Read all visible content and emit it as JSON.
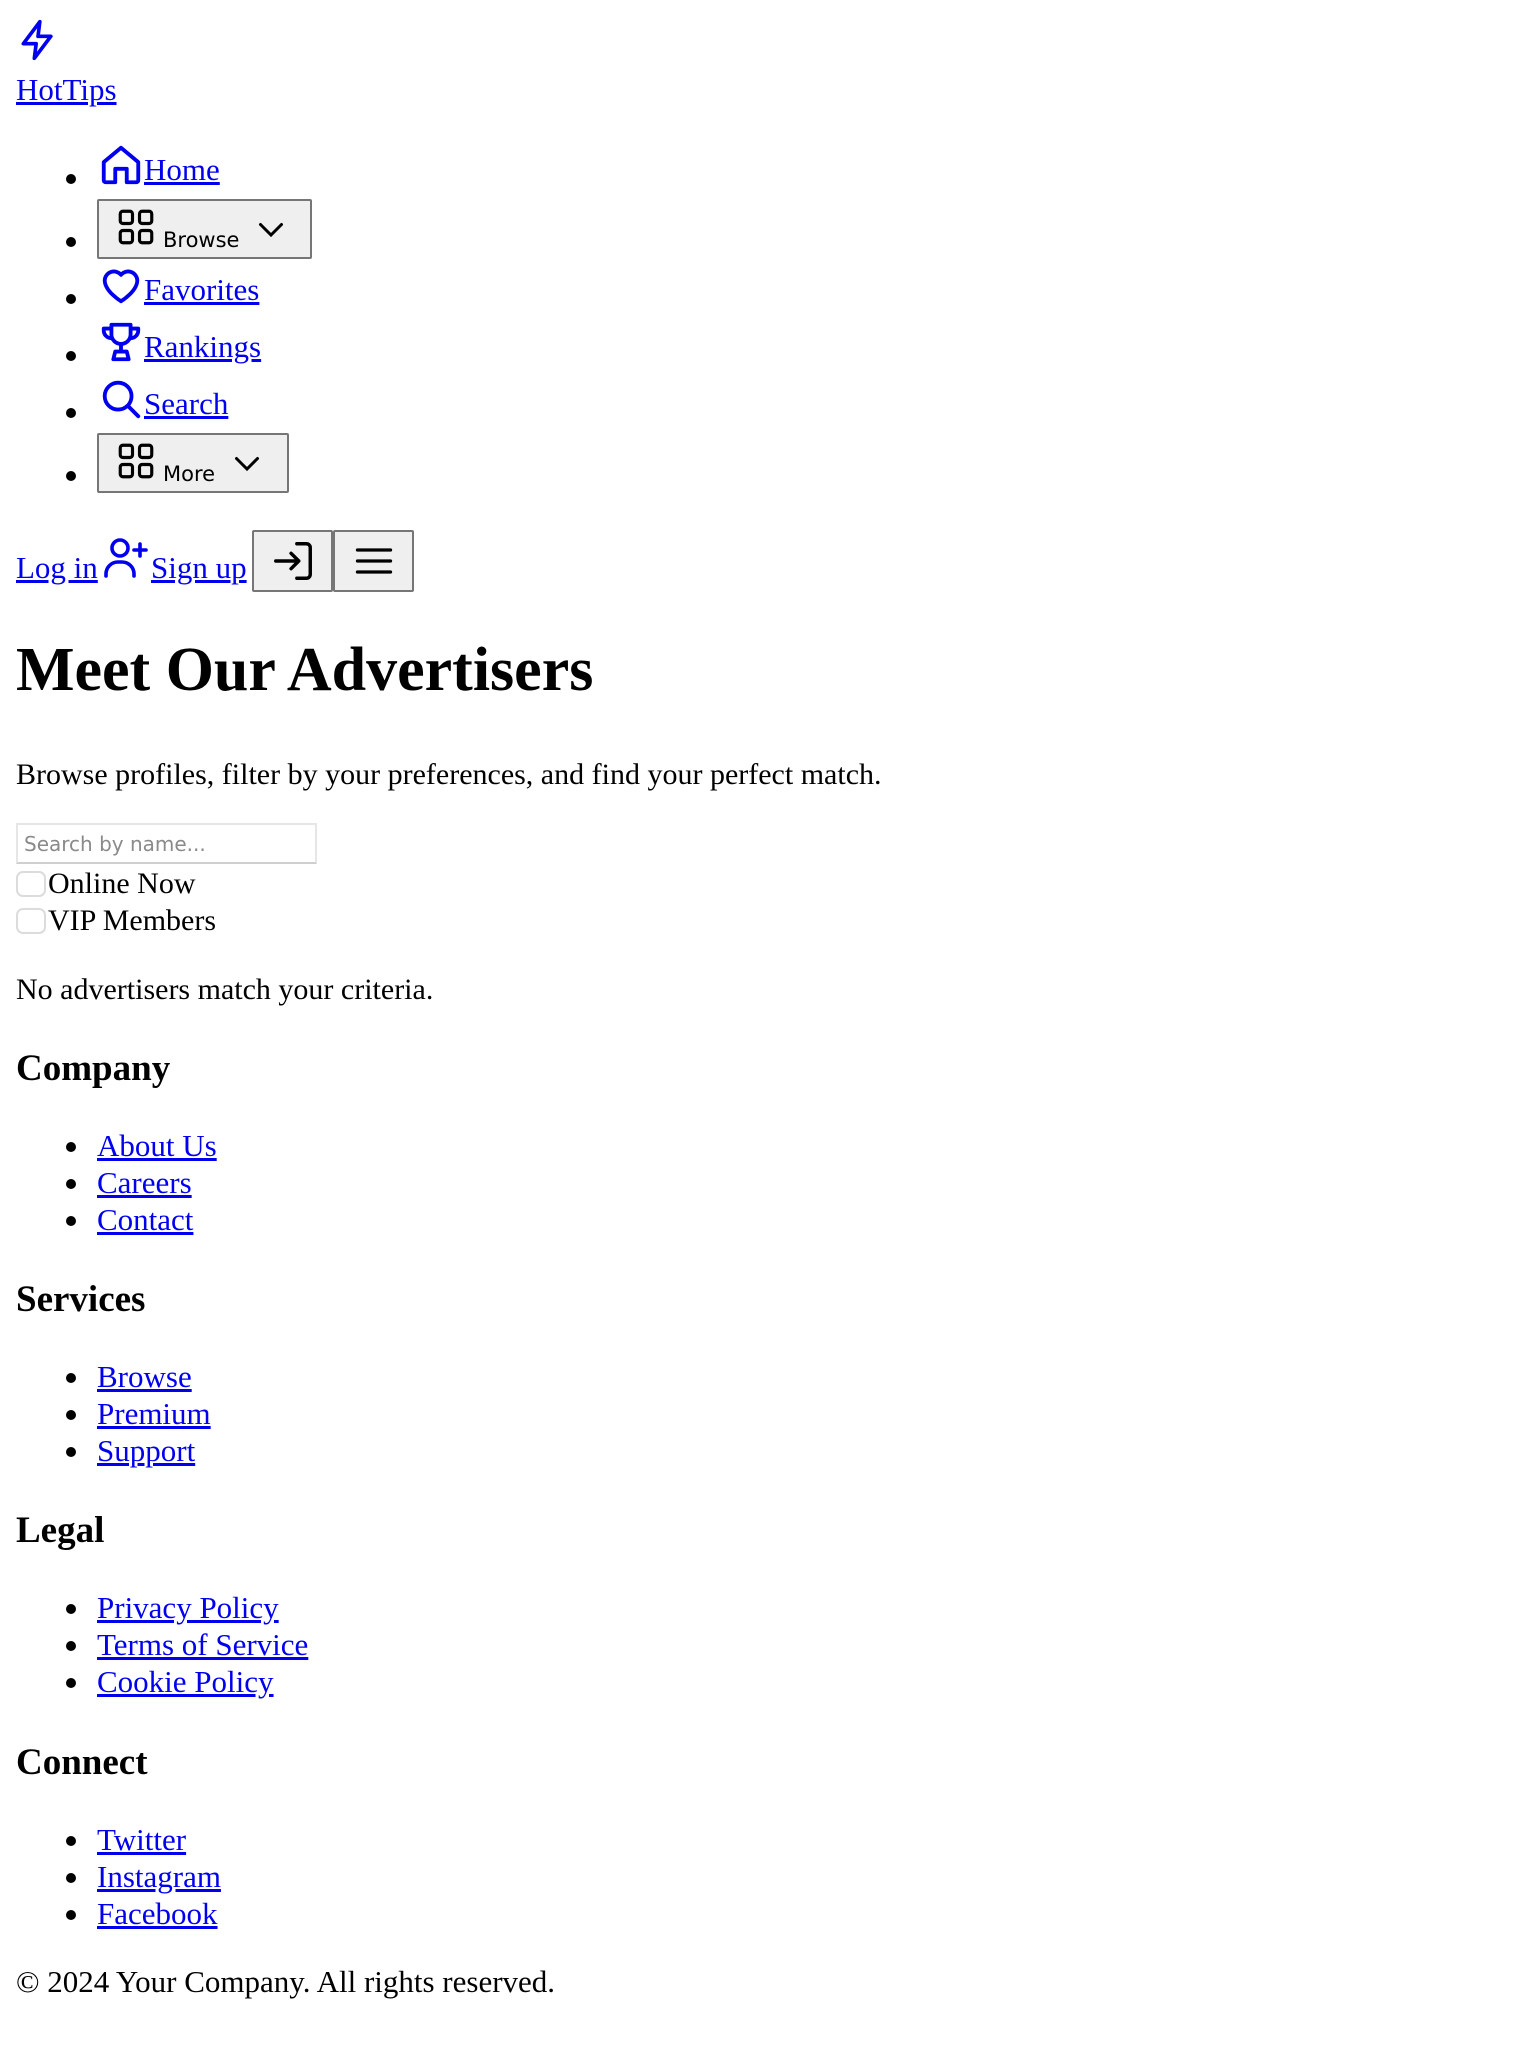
{
  "brand": {
    "name": "HotTips",
    "icon": "lightning-icon"
  },
  "nav": {
    "items": [
      {
        "label": "Home",
        "icon": "home-icon",
        "type": "link"
      },
      {
        "label": "Browse",
        "icon": "grid-icon",
        "type": "dropdown"
      },
      {
        "label": "Favorites",
        "icon": "heart-icon",
        "type": "link"
      },
      {
        "label": "Rankings",
        "icon": "trophy-icon",
        "type": "link"
      },
      {
        "label": "Search",
        "icon": "search-icon",
        "type": "link"
      },
      {
        "label": "More",
        "icon": "grid-icon",
        "type": "dropdown"
      }
    ]
  },
  "auth": {
    "login_label": "Log in",
    "signup_label": "Sign up",
    "signup_icon": "user-plus-icon",
    "login_button_icon": "log-in-icon",
    "menu_button_icon": "hamburger-menu-icon"
  },
  "hero": {
    "title": "Meet Our Advertisers",
    "subtitle": "Browse profiles, filter by your preferences, and find your perfect match."
  },
  "filters": {
    "search_placeholder": "Search by name...",
    "search_value": "",
    "online_label": "Online Now",
    "online_checked": false,
    "vip_label": "VIP Members",
    "vip_checked": false
  },
  "results": {
    "empty_message": "No advertisers match your criteria."
  },
  "footer": {
    "sections": [
      {
        "heading": "Company",
        "links": [
          "About Us",
          "Careers",
          "Contact"
        ]
      },
      {
        "heading": "Services",
        "links": [
          "Browse",
          "Premium",
          "Support"
        ]
      },
      {
        "heading": "Legal",
        "links": [
          "Privacy Policy",
          "Terms of Service",
          "Cookie Policy"
        ]
      },
      {
        "heading": "Connect",
        "links": [
          "Twitter",
          "Instagram",
          "Facebook"
        ]
      }
    ],
    "copyright": "© 2024 Your Company. All rights reserved."
  },
  "colors": {
    "link": "#0000ee",
    "text": "#000000",
    "button_bg": "#efefef",
    "button_border": "#767676"
  }
}
